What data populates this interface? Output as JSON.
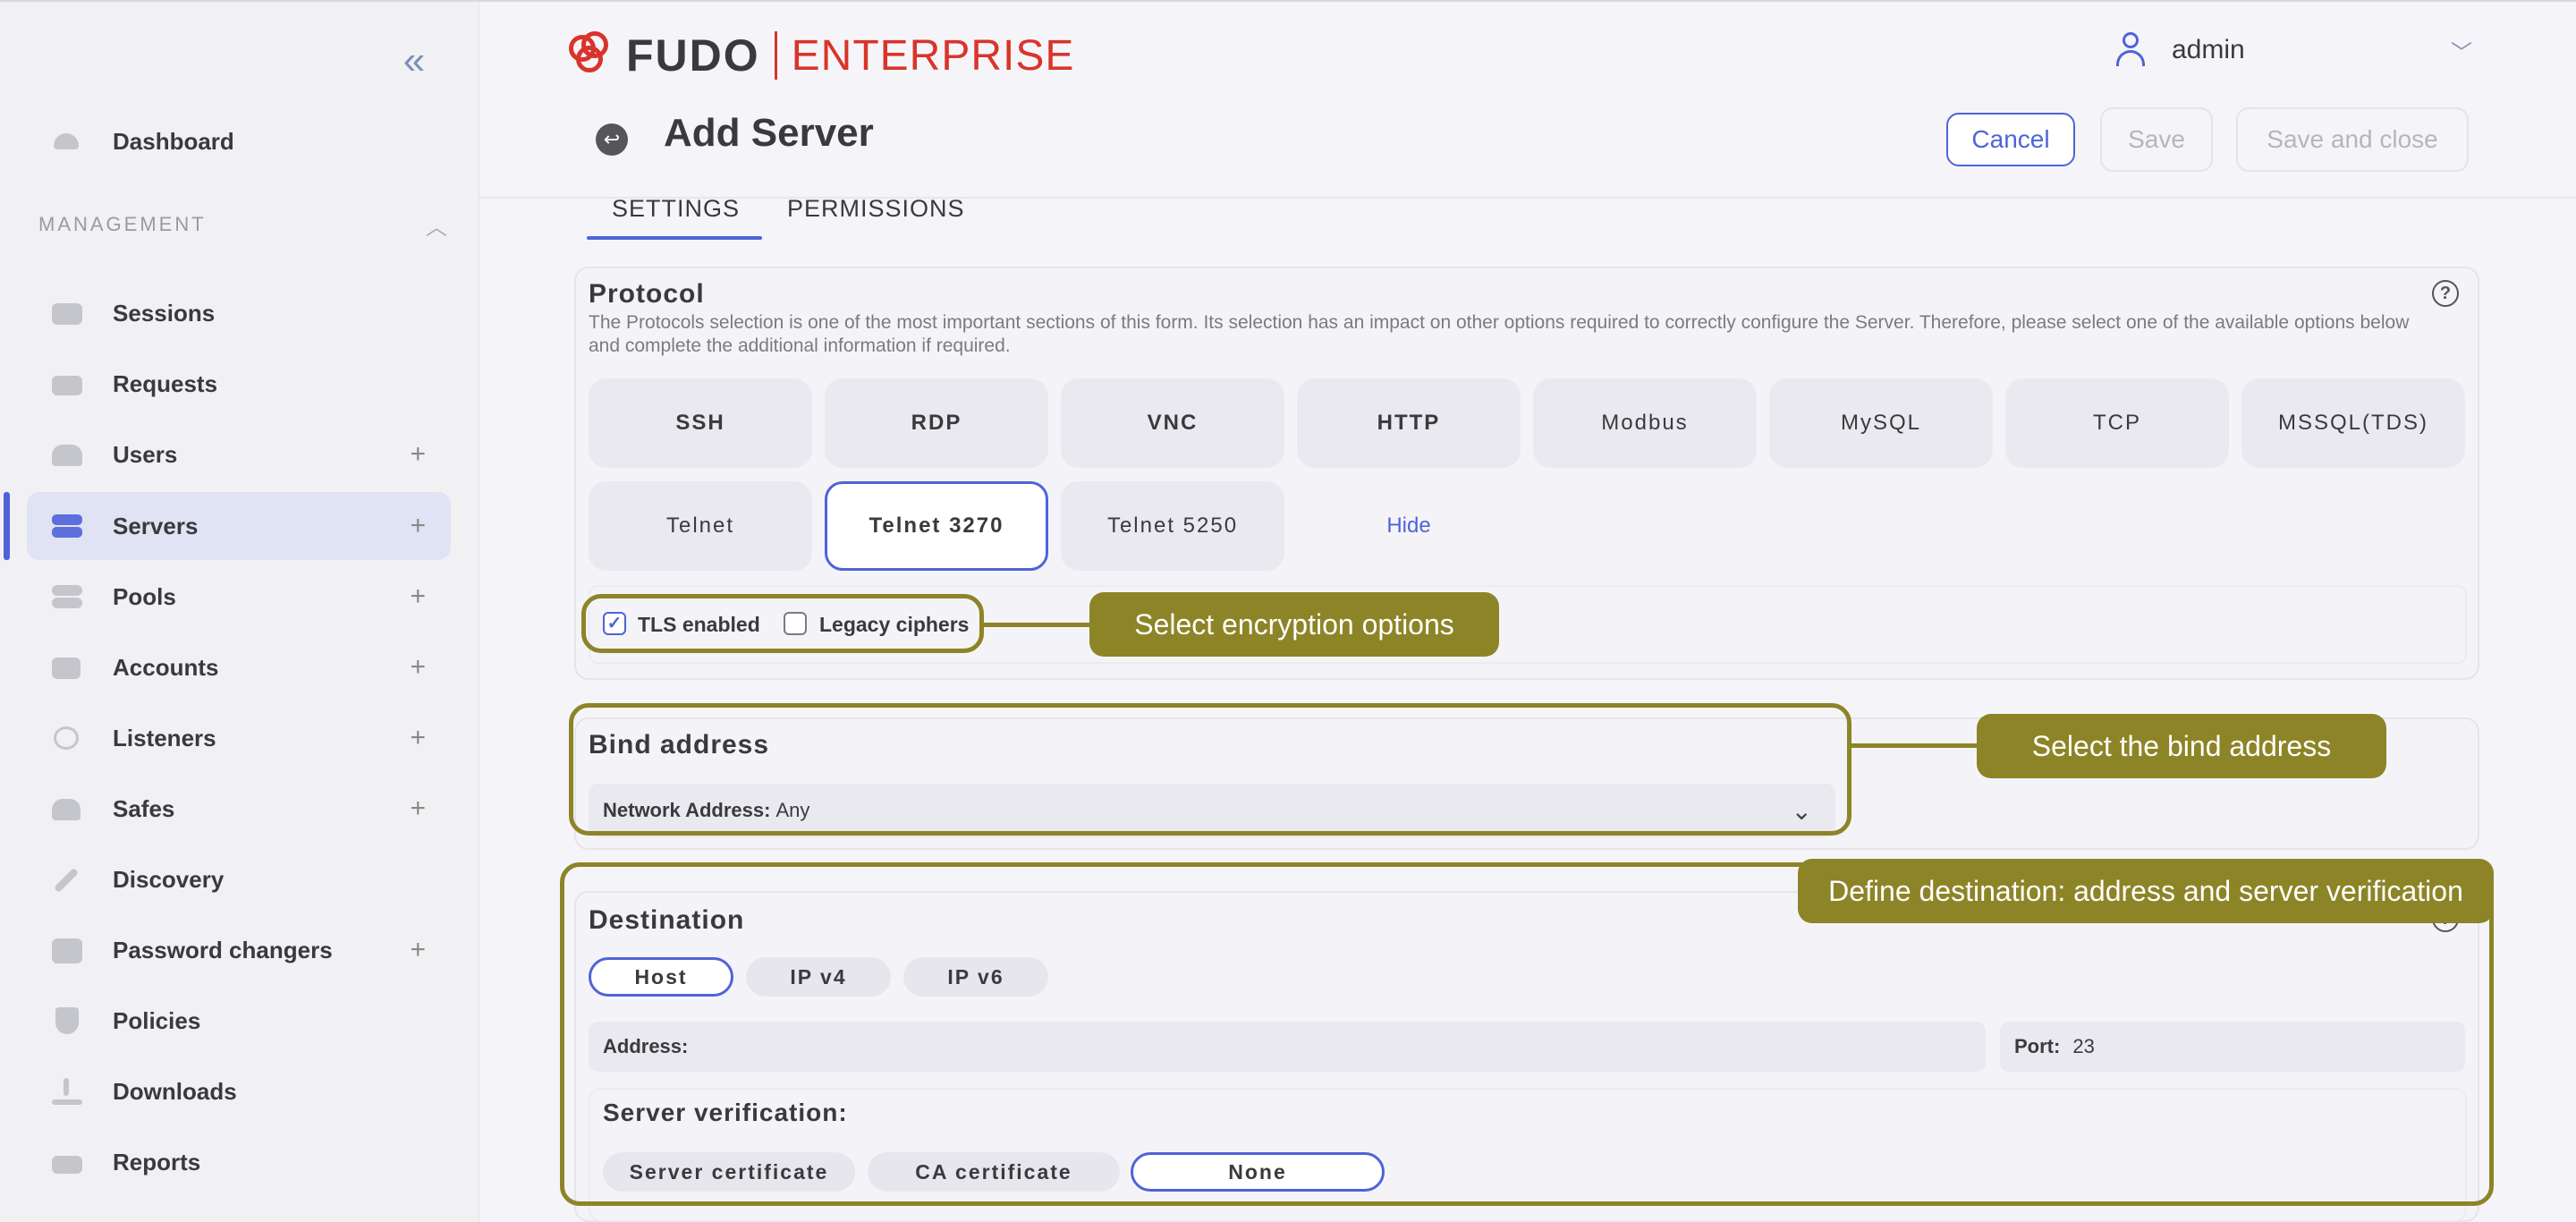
{
  "sidebar": {
    "dashboard": "Dashboard",
    "management_heading": "MANAGEMENT",
    "items": [
      {
        "label": "Sessions"
      },
      {
        "label": "Requests"
      },
      {
        "label": "Users"
      },
      {
        "label": "Servers"
      },
      {
        "label": "Pools"
      },
      {
        "label": "Accounts"
      },
      {
        "label": "Listeners"
      },
      {
        "label": "Safes"
      },
      {
        "label": "Discovery"
      },
      {
        "label": "Password changers"
      },
      {
        "label": "Policies"
      },
      {
        "label": "Downloads"
      },
      {
        "label": "Reports"
      }
    ],
    "plus": "+",
    "collapse_icon": "«"
  },
  "header": {
    "logo_brand": "FUDO",
    "logo_edition": "ENTERPRISE",
    "user_name": "admin",
    "page_title": "Add Server",
    "cancel_label": "Cancel",
    "save_label": "Save",
    "save_close_label": "Save and close"
  },
  "tabs": {
    "settings": "SETTINGS",
    "permissions": "PERMISSIONS"
  },
  "protocol": {
    "title": "Protocol",
    "description": "The Protocols selection is one of the most important sections of this form. Its selection has an impact on other options required to correctly configure the Server. Therefore, please select one of the available options below and complete the additional information if required.",
    "options_row1": [
      "SSH",
      "RDP",
      "VNC",
      "HTTP",
      "Modbus",
      "MySQL",
      "TCP",
      "MSSQL(TDS)"
    ],
    "options_row2": [
      "Telnet",
      "Telnet 3270",
      "Telnet 5250"
    ],
    "selected": "Telnet 3270",
    "hide_label": "Hide",
    "tls_label": "TLS enabled",
    "legacy_label": "Legacy ciphers"
  },
  "bind": {
    "title": "Bind address",
    "field_label": "Network Address:",
    "field_value": "Any"
  },
  "destination": {
    "title": "Destination",
    "types": [
      "Host",
      "IP v4",
      "IP v6"
    ],
    "selected_type": "Host",
    "address_label": "Address:",
    "port_label": "Port:",
    "port_value": "23",
    "verification_title": "Server verification:",
    "verification_options": [
      "Server certificate",
      "CA certificate",
      "None"
    ],
    "verification_selected": "None"
  },
  "callouts": {
    "encryption": "Select encryption options",
    "bind": "Select the bind address",
    "destination": "Define destination: address and server verification"
  },
  "colors": {
    "accent": "#4f63d8",
    "annotation": "#8d8427",
    "brand": "#d9342b"
  }
}
